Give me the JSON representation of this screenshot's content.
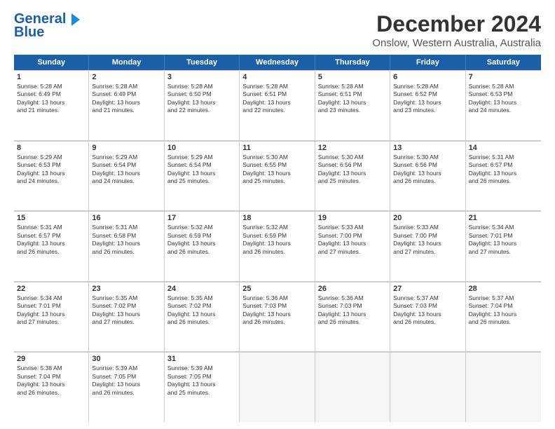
{
  "logo": {
    "line1": "General",
    "line2": "Blue"
  },
  "title": "December 2024",
  "subtitle": "Onslow, Western Australia, Australia",
  "days_of_week": [
    "Sunday",
    "Monday",
    "Tuesday",
    "Wednesday",
    "Thursday",
    "Friday",
    "Saturday"
  ],
  "weeks": [
    [
      {
        "day": "1",
        "lines": [
          "Sunrise: 5:28 AM",
          "Sunset: 6:49 PM",
          "Daylight: 13 hours",
          "and 21 minutes."
        ]
      },
      {
        "day": "2",
        "lines": [
          "Sunrise: 5:28 AM",
          "Sunset: 6:49 PM",
          "Daylight: 13 hours",
          "and 21 minutes."
        ]
      },
      {
        "day": "3",
        "lines": [
          "Sunrise: 5:28 AM",
          "Sunset: 6:50 PM",
          "Daylight: 13 hours",
          "and 22 minutes."
        ]
      },
      {
        "day": "4",
        "lines": [
          "Sunrise: 5:28 AM",
          "Sunset: 6:51 PM",
          "Daylight: 13 hours",
          "and 22 minutes."
        ]
      },
      {
        "day": "5",
        "lines": [
          "Sunrise: 5:28 AM",
          "Sunset: 6:51 PM",
          "Daylight: 13 hours",
          "and 23 minutes."
        ]
      },
      {
        "day": "6",
        "lines": [
          "Sunrise: 5:28 AM",
          "Sunset: 6:52 PM",
          "Daylight: 13 hours",
          "and 23 minutes."
        ]
      },
      {
        "day": "7",
        "lines": [
          "Sunrise: 5:28 AM",
          "Sunset: 6:53 PM",
          "Daylight: 13 hours",
          "and 24 minutes."
        ]
      }
    ],
    [
      {
        "day": "8",
        "lines": [
          "Sunrise: 5:29 AM",
          "Sunset: 6:53 PM",
          "Daylight: 13 hours",
          "and 24 minutes."
        ]
      },
      {
        "day": "9",
        "lines": [
          "Sunrise: 5:29 AM",
          "Sunset: 6:54 PM",
          "Daylight: 13 hours",
          "and 24 minutes."
        ]
      },
      {
        "day": "10",
        "lines": [
          "Sunrise: 5:29 AM",
          "Sunset: 6:54 PM",
          "Daylight: 13 hours",
          "and 25 minutes."
        ]
      },
      {
        "day": "11",
        "lines": [
          "Sunrise: 5:30 AM",
          "Sunset: 6:55 PM",
          "Daylight: 13 hours",
          "and 25 minutes."
        ]
      },
      {
        "day": "12",
        "lines": [
          "Sunrise: 5:30 AM",
          "Sunset: 6:56 PM",
          "Daylight: 13 hours",
          "and 25 minutes."
        ]
      },
      {
        "day": "13",
        "lines": [
          "Sunrise: 5:30 AM",
          "Sunset: 6:56 PM",
          "Daylight: 13 hours",
          "and 26 minutes."
        ]
      },
      {
        "day": "14",
        "lines": [
          "Sunrise: 5:31 AM",
          "Sunset: 6:57 PM",
          "Daylight: 13 hours",
          "and 26 minutes."
        ]
      }
    ],
    [
      {
        "day": "15",
        "lines": [
          "Sunrise: 5:31 AM",
          "Sunset: 6:57 PM",
          "Daylight: 13 hours",
          "and 26 minutes."
        ]
      },
      {
        "day": "16",
        "lines": [
          "Sunrise: 5:31 AM",
          "Sunset: 6:58 PM",
          "Daylight: 13 hours",
          "and 26 minutes."
        ]
      },
      {
        "day": "17",
        "lines": [
          "Sunrise: 5:32 AM",
          "Sunset: 6:59 PM",
          "Daylight: 13 hours",
          "and 26 minutes."
        ]
      },
      {
        "day": "18",
        "lines": [
          "Sunrise: 5:32 AM",
          "Sunset: 6:59 PM",
          "Daylight: 13 hours",
          "and 26 minutes."
        ]
      },
      {
        "day": "19",
        "lines": [
          "Sunrise: 5:33 AM",
          "Sunset: 7:00 PM",
          "Daylight: 13 hours",
          "and 27 minutes."
        ]
      },
      {
        "day": "20",
        "lines": [
          "Sunrise: 5:33 AM",
          "Sunset: 7:00 PM",
          "Daylight: 13 hours",
          "and 27 minutes."
        ]
      },
      {
        "day": "21",
        "lines": [
          "Sunrise: 5:34 AM",
          "Sunset: 7:01 PM",
          "Daylight: 13 hours",
          "and 27 minutes."
        ]
      }
    ],
    [
      {
        "day": "22",
        "lines": [
          "Sunrise: 5:34 AM",
          "Sunset: 7:01 PM",
          "Daylight: 13 hours",
          "and 27 minutes."
        ]
      },
      {
        "day": "23",
        "lines": [
          "Sunrise: 5:35 AM",
          "Sunset: 7:02 PM",
          "Daylight: 13 hours",
          "and 27 minutes."
        ]
      },
      {
        "day": "24",
        "lines": [
          "Sunrise: 5:35 AM",
          "Sunset: 7:02 PM",
          "Daylight: 13 hours",
          "and 26 minutes."
        ]
      },
      {
        "day": "25",
        "lines": [
          "Sunrise: 5:36 AM",
          "Sunset: 7:03 PM",
          "Daylight: 13 hours",
          "and 26 minutes."
        ]
      },
      {
        "day": "26",
        "lines": [
          "Sunrise: 5:36 AM",
          "Sunset: 7:03 PM",
          "Daylight: 13 hours",
          "and 26 minutes."
        ]
      },
      {
        "day": "27",
        "lines": [
          "Sunrise: 5:37 AM",
          "Sunset: 7:03 PM",
          "Daylight: 13 hours",
          "and 26 minutes."
        ]
      },
      {
        "day": "28",
        "lines": [
          "Sunrise: 5:37 AM",
          "Sunset: 7:04 PM",
          "Daylight: 13 hours",
          "and 26 minutes."
        ]
      }
    ],
    [
      {
        "day": "29",
        "lines": [
          "Sunrise: 5:38 AM",
          "Sunset: 7:04 PM",
          "Daylight: 13 hours",
          "and 26 minutes."
        ]
      },
      {
        "day": "30",
        "lines": [
          "Sunrise: 5:39 AM",
          "Sunset: 7:05 PM",
          "Daylight: 13 hours",
          "and 26 minutes."
        ]
      },
      {
        "day": "31",
        "lines": [
          "Sunrise: 5:39 AM",
          "Sunset: 7:05 PM",
          "Daylight: 13 hours",
          "and 25 minutes."
        ]
      },
      null,
      null,
      null,
      null
    ]
  ]
}
